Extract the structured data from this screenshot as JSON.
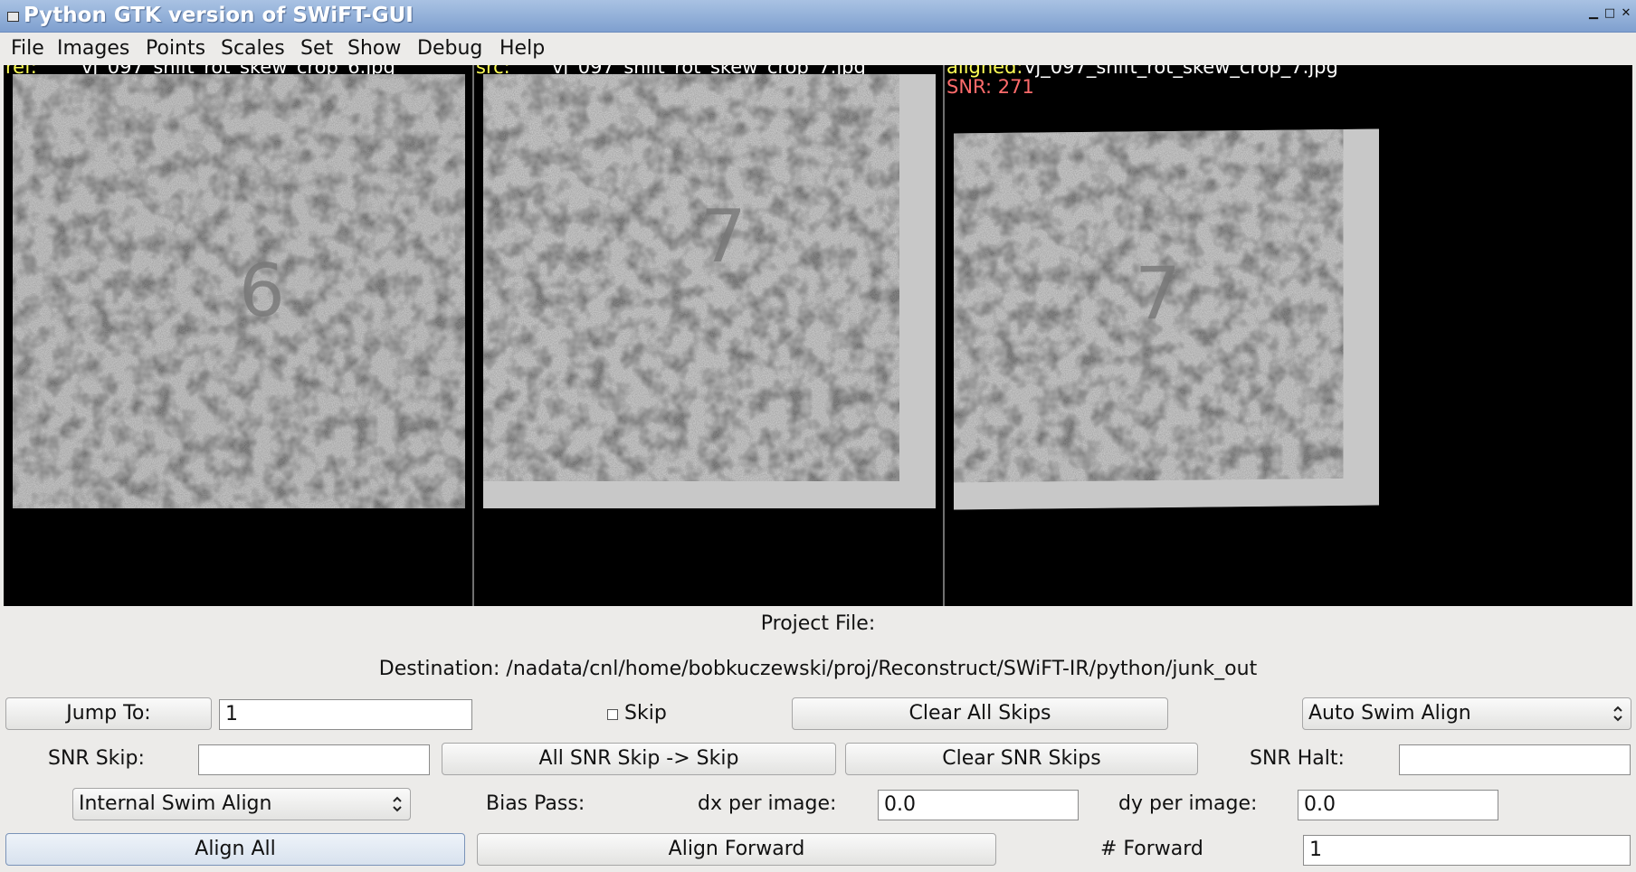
{
  "window": {
    "title": "Python GTK version of SWiFT-GUI",
    "controls": [
      "minimize-icon",
      "maximize-icon",
      "close-icon"
    ]
  },
  "menu": [
    "File",
    "Images",
    "Points",
    "Scales",
    "Set",
    "Show",
    "Debug",
    "Help"
  ],
  "panels": {
    "ref": {
      "key": "ref:",
      "filename": "vj_097_shift_rot_skew_crop_6.jpg",
      "digit": "6"
    },
    "src": {
      "key": "src:",
      "filename": "vj_097_shift_rot_skew_crop_7.jpg",
      "digit": "7"
    },
    "aligned": {
      "key": "aligned:",
      "filename": "vj_097_shift_rot_skew_crop_7.jpg",
      "snr": "SNR: 271",
      "digit": "7"
    }
  },
  "info": {
    "project_file": "Project File:",
    "destination": "Destination: /nadata/cnl/home/bobkuczewski/proj/Reconstruct/SWiFT-IR/python/junk_out"
  },
  "controls": {
    "jump_to_label": "Jump To:",
    "jump_to_value": "1",
    "skip_label": "Skip",
    "skip_checked": false,
    "clear_all_skips": "Clear All Skips",
    "auto_swim_align": "Auto Swim Align",
    "snr_skip_label": "SNR Skip:",
    "snr_skip_value": "",
    "all_snr_skip": "All SNR Skip -> Skip",
    "clear_snr_skips": "Clear SNR Skips",
    "snr_halt_label": "SNR Halt:",
    "snr_halt_value": "",
    "internal_swim_align": "Internal Swim Align",
    "bias_pass_label": "Bias Pass:",
    "dx_label": "dx per image:",
    "dx_value": "0.0",
    "dy_label": "dy per image:",
    "dy_value": "0.0",
    "align_all": "Align All",
    "align_forward": "Align Forward",
    "forward_label": "# Forward",
    "forward_value": "1"
  },
  "colors": {
    "titlebar": "#8fabd6",
    "label_key": "#ffff55",
    "snr": "#ff6b6b",
    "background": "#ecebe9"
  }
}
